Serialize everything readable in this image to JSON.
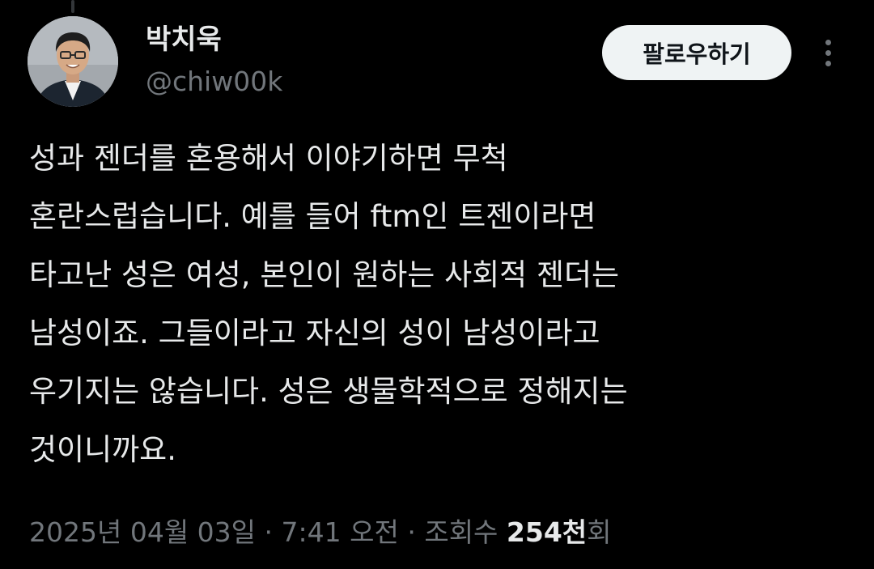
{
  "author": {
    "display_name": "박치욱",
    "handle": "@chiw00k",
    "avatar_icon": "profile-photo"
  },
  "actions": {
    "follow_label": "팔로우하기",
    "more_icon": "more-vertical-icon"
  },
  "tweet": {
    "lines": [
      "성과 젠더를 혼용해서 이야기하면 무척",
      "혼란스럽습니다. 예를 들어 ftm인 트젠이라면",
      "타고난 성은 여성, 본인이 원하는 사회적 젠더는",
      "남성이죠. 그들이라고 자신의 성이 남성이라고",
      "우기지는 않습니다. 성은 생물학적으로 정해지는",
      "것이니까요."
    ]
  },
  "meta": {
    "date": "2025년 04월 03일",
    "separator": " · ",
    "time": "7:41 오전",
    "views_label": "조회수 ",
    "views_count": "254천",
    "views_suffix": "회"
  },
  "colors": {
    "background": "#000000",
    "primary_text": "#e7e9ea",
    "secondary_text": "#71767b",
    "button_bg": "#eff3f4",
    "button_text": "#0f1419"
  }
}
